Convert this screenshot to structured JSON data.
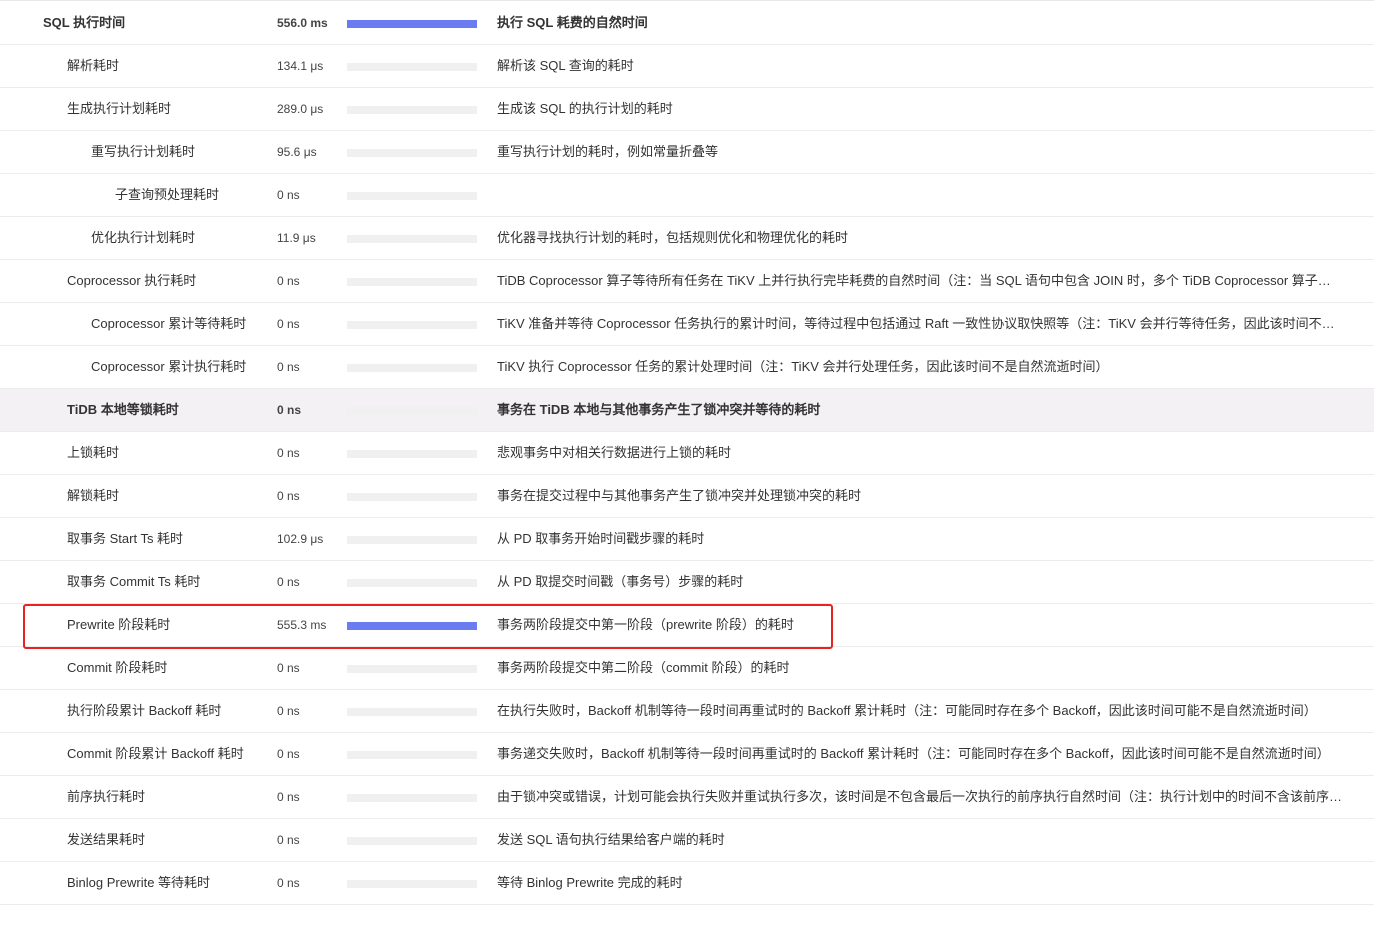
{
  "rows": [
    {
      "name": "SQL 执行时间",
      "level": 0,
      "value": "556.0 ms",
      "bar": 1.0,
      "desc": "执行 SQL 耗费的自然时间",
      "bold": true,
      "highlight": false
    },
    {
      "name": "解析耗时",
      "level": 1,
      "value": "134.1 μs",
      "bar": 0.0002,
      "desc": "解析该 SQL 查询的耗时",
      "bold": false,
      "highlight": false
    },
    {
      "name": "生成执行计划耗时",
      "level": 1,
      "value": "289.0 μs",
      "bar": 0.0005,
      "desc": "生成该 SQL 的执行计划的耗时",
      "bold": false,
      "highlight": false
    },
    {
      "name": "重写执行计划耗时",
      "level": 2,
      "value": "95.6 μs",
      "bar": 0.0002,
      "desc": "重写执行计划的耗时，例如常量折叠等",
      "bold": false,
      "highlight": false
    },
    {
      "name": "子查询预处理耗时",
      "level": 3,
      "value": "0 ns",
      "bar": 0,
      "desc": "",
      "bold": false,
      "highlight": false
    },
    {
      "name": "优化执行计划耗时",
      "level": 2,
      "value": "11.9 μs",
      "bar": 2e-05,
      "desc": "优化器寻找执行计划的耗时，包括规则优化和物理优化的耗时",
      "bold": false,
      "highlight": false
    },
    {
      "name": "Coprocessor 执行耗时",
      "level": 1,
      "value": "0 ns",
      "bar": 0,
      "desc": "TiDB Coprocessor 算子等待所有任务在 TiKV 上并行执行完毕耗费的自然时间（注：当 SQL 语句中包含 JOIN 时，多个 TiDB Coprocessor 算子可…",
      "bold": false,
      "highlight": false
    },
    {
      "name": "Coprocessor 累计等待耗时",
      "level": 2,
      "value": "0 ns",
      "bar": 0,
      "desc": "TiKV 准备并等待 Coprocessor 任务执行的累计时间，等待过程中包括通过 Raft 一致性协议取快照等（注：TiKV 会并行等待任务，因此该时间不…",
      "bold": false,
      "highlight": false
    },
    {
      "name": "Coprocessor 累计执行耗时",
      "level": 2,
      "value": "0 ns",
      "bar": 0,
      "desc": "TiKV 执行 Coprocessor 任务的累计处理时间（注：TiKV 会并行处理任务，因此该时间不是自然流逝时间）",
      "bold": false,
      "highlight": false
    },
    {
      "name": "TiDB 本地等锁耗时",
      "level": 1,
      "value": "0 ns",
      "bar": 0,
      "desc": "事务在 TiDB 本地与其他事务产生了锁冲突并等待的耗时",
      "bold": true,
      "highlight": true
    },
    {
      "name": "上锁耗时",
      "level": 1,
      "value": "0 ns",
      "bar": 0,
      "desc": "悲观事务中对相关行数据进行上锁的耗时",
      "bold": false,
      "highlight": false
    },
    {
      "name": "解锁耗时",
      "level": 1,
      "value": "0 ns",
      "bar": 0,
      "desc": "事务在提交过程中与其他事务产生了锁冲突并处理锁冲突的耗时",
      "bold": false,
      "highlight": false
    },
    {
      "name": "取事务 Start Ts 耗时",
      "level": 1,
      "value": "102.9 μs",
      "bar": 0.0002,
      "desc": "从 PD 取事务开始时间戳步骤的耗时",
      "bold": false,
      "highlight": false
    },
    {
      "name": "取事务 Commit Ts 耗时",
      "level": 1,
      "value": "0 ns",
      "bar": 0,
      "desc": "从 PD 取提交时间戳（事务号）步骤的耗时",
      "bold": false,
      "highlight": false
    },
    {
      "name": "Prewrite 阶段耗时",
      "level": 1,
      "value": "555.3 ms",
      "bar": 0.9987,
      "desc": "事务两阶段提交中第一阶段（prewrite 阶段）的耗时",
      "bold": false,
      "highlight": false
    },
    {
      "name": "Commit 阶段耗时",
      "level": 1,
      "value": "0 ns",
      "bar": 0,
      "desc": "事务两阶段提交中第二阶段（commit 阶段）的耗时",
      "bold": false,
      "highlight": false
    },
    {
      "name": "执行阶段累计 Backoff 耗时",
      "level": 1,
      "value": "0 ns",
      "bar": 0,
      "desc": "在执行失败时，Backoff 机制等待一段时间再重试时的 Backoff 累计耗时（注：可能同时存在多个 Backoff，因此该时间可能不是自然流逝时间）",
      "bold": false,
      "highlight": false
    },
    {
      "name": "Commit 阶段累计 Backoff 耗时",
      "level": 1,
      "value": "0 ns",
      "bar": 0,
      "desc": "事务递交失败时，Backoff 机制等待一段时间再重试时的 Backoff 累计耗时（注：可能同时存在多个 Backoff，因此该时间可能不是自然流逝时间）",
      "bold": false,
      "highlight": false
    },
    {
      "name": "前序执行耗时",
      "level": 1,
      "value": "0 ns",
      "bar": 0,
      "desc": "由于锁冲突或错误，计划可能会执行失败并重试执行多次，该时间是不包含最后一次执行的前序执行自然时间（注：执行计划中的时间不含该前序…",
      "bold": false,
      "highlight": false
    },
    {
      "name": "发送结果耗时",
      "level": 1,
      "value": "0 ns",
      "bar": 0,
      "desc": "发送 SQL 语句执行结果给客户端的耗时",
      "bold": false,
      "highlight": false
    },
    {
      "name": "Binlog Prewrite 等待耗时",
      "level": 1,
      "value": "0 ns",
      "bar": 0,
      "desc": "等待 Binlog Prewrite 完成的耗时",
      "bold": false,
      "highlight": false
    }
  ],
  "colors": {
    "bar": "#6b7bf0",
    "track": "#f0f0f0",
    "highlight_row": "#f4f1f5",
    "annotation": "#e8231f"
  }
}
